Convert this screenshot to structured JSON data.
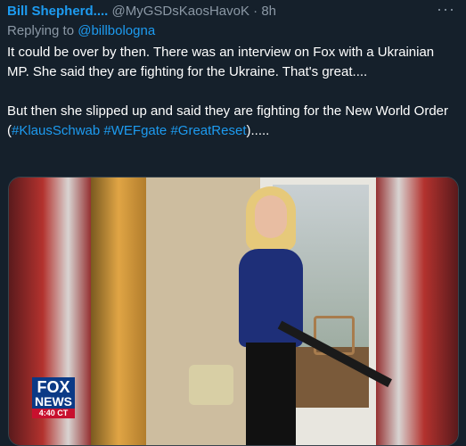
{
  "tweet": {
    "author_name": "Bill Shepherd....",
    "handle": "@MyGSDsKaosHavoK",
    "separator": "·",
    "time": "8h",
    "more_label": "···",
    "replying_prefix": "Replying to",
    "replying_to": "@billbologna",
    "paragraph1": "It could be over by then. There was an interview on Fox with a Ukrainian MP. She said they are fighting for the Ukraine. That's great....",
    "paragraph2_text": "But then she slipped up and said they are fighting for the New World Order",
    "hashtags_open": "(",
    "hashtag1": "#KlausSchwab",
    "hashtag2": "#WEFgate",
    "hashtag3": "#GreatReset",
    "hashtags_close": ")....."
  },
  "media": {
    "logo_line1": "FOX",
    "logo_line2": "NEWS",
    "logo_clock": "4:40 CT"
  }
}
